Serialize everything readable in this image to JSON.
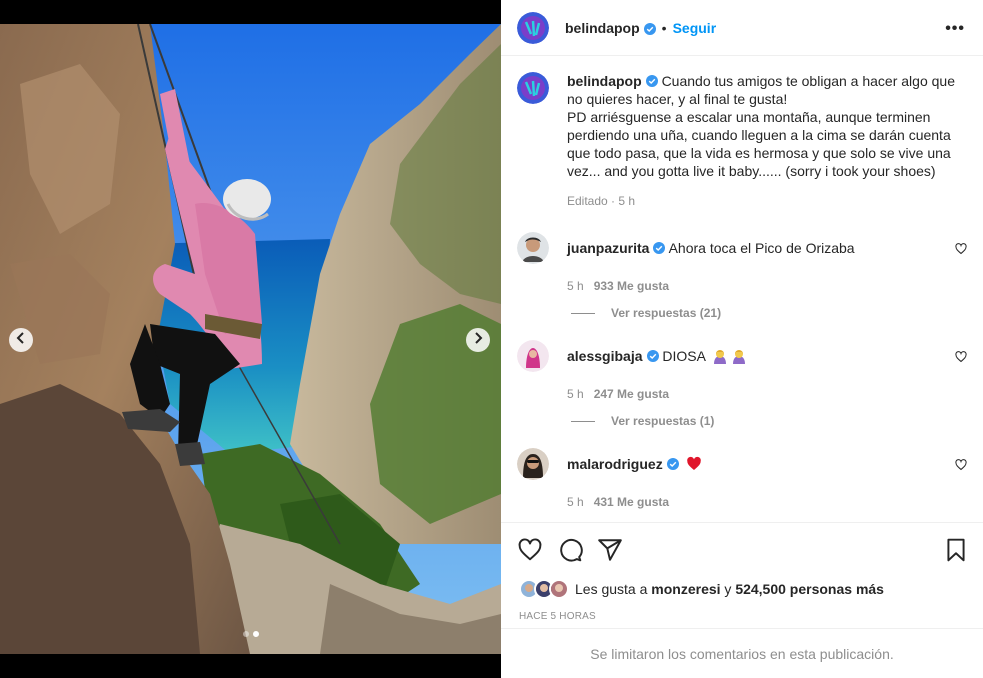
{
  "post": {
    "author": "belindapop",
    "follow_label": "Seguir",
    "separator": "•",
    "more_label": "•••",
    "caption_lines": [
      "Cuando tus amigos te obligan a hacer algo que",
      "no quieres hacer, y al final te gusta!",
      "PD arriésguense a escalar una montaña, aunque terminen",
      "perdiendo una uña, cuando lleguen a la cima se darán cuenta",
      "que todo pasa, que la vida es hermosa y que solo se vive una",
      "vez... and you gotta live it baby...... (sorry i took your shoes)"
    ],
    "caption_meta": "Editado · 5 h"
  },
  "comments": [
    {
      "user": "juanpazurita",
      "text": "Ahora toca el Pico de Orizaba",
      "time": "5 h",
      "likes": "933 Me gusta",
      "replies": "Ver respuestas (21)",
      "verified": true
    },
    {
      "user": "alessgibaja",
      "text": "DIOSA",
      "time": "5 h",
      "likes": "247 Me gusta",
      "replies": "Ver respuestas (1)",
      "verified": true
    },
    {
      "user": "malarodriguez",
      "text": "",
      "time": "5 h",
      "likes": "431 Me gusta",
      "verified": true
    }
  ],
  "likes_summary": {
    "prefix": "Les gusta a",
    "user": "monzeresi",
    "connector": "y",
    "count": "524,500 personas más"
  },
  "time_ago": "HACE 5 HORAS",
  "footer_text": "Se limitaron los comentarios en esta publicación.",
  "icons": {
    "prev": "chevron-left-icon",
    "next": "chevron-right-icon",
    "like": "heart-icon",
    "comment": "comment-icon",
    "share": "share-icon",
    "save": "bookmark-icon"
  },
  "colors": {
    "accent": "#0095f6",
    "muted": "#8e8e8e",
    "text": "#262626",
    "heart_emoji": "#e0162b"
  },
  "carousel": {
    "total": 2,
    "active": 2
  }
}
